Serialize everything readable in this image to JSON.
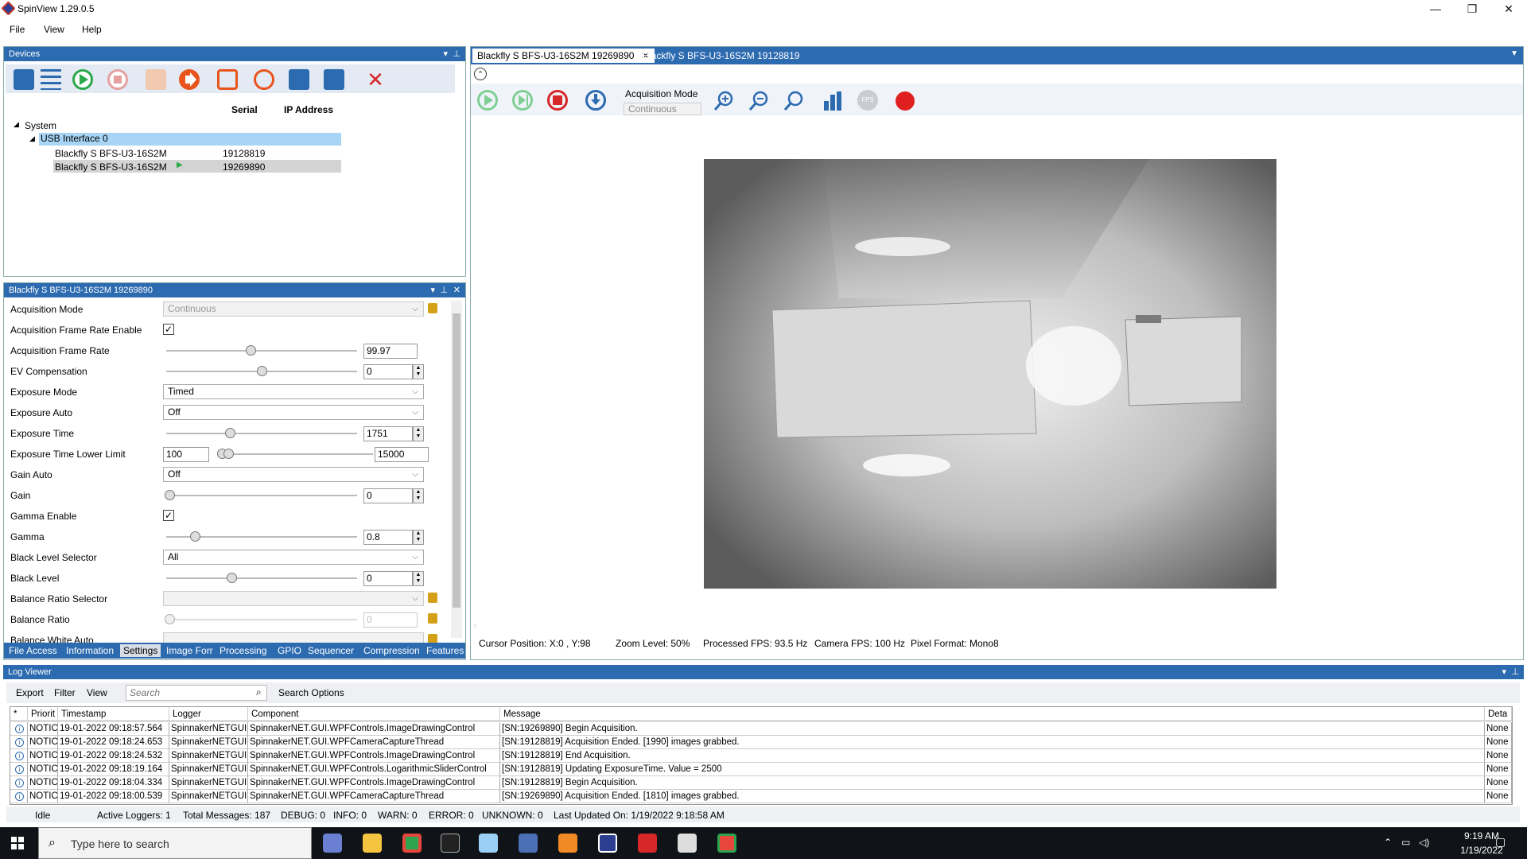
{
  "window": {
    "title": "SpinView 1.29.0.5",
    "minimize": "—",
    "restore": "❐",
    "close": "✕"
  },
  "menu": [
    "File",
    "View",
    "Help"
  ],
  "devices_panel": {
    "title": "Devices",
    "col_serial": "Serial",
    "col_ip": "IP Address",
    "tree": {
      "system": "System",
      "usb": "USB Interface 0",
      "cam1_name": "Blackfly S BFS-U3-16S2M",
      "cam1_serial": "19128819",
      "cam2_name": "Blackfly S BFS-U3-16S2M",
      "cam2_serial": "19269890"
    }
  },
  "props_panel": {
    "title": "Blackfly S BFS-U3-16S2M 19269890",
    "rows": {
      "acq_mode": {
        "label": "Acquisition Mode",
        "value": "Continuous"
      },
      "afr_enable": {
        "label": "Acquisition Frame Rate Enable",
        "checked": "✓"
      },
      "afr": {
        "label": "Acquisition Frame Rate",
        "value": "99.97"
      },
      "ev": {
        "label": "EV Compensation",
        "value": "0"
      },
      "exp_mode": {
        "label": "Exposure Mode",
        "value": "Timed"
      },
      "exp_auto": {
        "label": "Exposure Auto",
        "value": "Off"
      },
      "exp_time": {
        "label": "Exposure Time",
        "value": "1751"
      },
      "exp_lower": {
        "label": "Exposure Time Lower Limit",
        "low": "100",
        "high": "15000"
      },
      "gain_auto": {
        "label": "Gain Auto",
        "value": "Off"
      },
      "gain": {
        "label": "Gain",
        "value": "0"
      },
      "gamma_enable": {
        "label": "Gamma Enable",
        "checked": "✓"
      },
      "gamma": {
        "label": "Gamma",
        "value": "0.8"
      },
      "bl_sel": {
        "label": "Black Level Selector",
        "value": "All"
      },
      "bl": {
        "label": "Black Level",
        "value": "0"
      },
      "br_sel": {
        "label": "Balance Ratio Selector",
        "value": ""
      },
      "br": {
        "label": "Balance Ratio",
        "value": "0"
      },
      "bw_auto": {
        "label": "Balance White Auto",
        "value": ""
      }
    },
    "tabs": [
      "File Access",
      "Information",
      "Settings",
      "Image Forr",
      "Processing",
      "GPIO",
      "Sequencer",
      "Compression",
      "Features"
    ]
  },
  "viewer": {
    "tab1": "Blackfly S BFS-U3-16S2M 19269890",
    "tab1_close": "✕",
    "tab2": "Blackfly S BFS-U3-16S2M 19128819",
    "acq_mode_label": "Acquisition Mode",
    "acq_mode_value": "Continuous",
    "status": {
      "cursor": "Cursor Position: X:0 , Y:98",
      "zoom": "Zoom Level: 50%",
      "proc_fps": "Processed FPS: 93.5 Hz",
      "cam_fps": "Camera FPS: 100 Hz",
      "pixfmt": "Pixel Format: Mono8"
    }
  },
  "log": {
    "title": "Log Viewer",
    "toolbar": {
      "export": "Export",
      "filter": "Filter",
      "view": "View",
      "search_placeholder": "Search",
      "search_options": "Search Options"
    },
    "headers": [
      "*",
      "Priorit",
      "Timestamp",
      "Logger",
      "Component",
      "Message",
      "Deta"
    ],
    "rows": [
      {
        "priority": "NOTICE",
        "timestamp": "19-01-2022 09:18:57.564",
        "logger": "SpinnakerNETGUI",
        "component": "SpinnakerNET.GUI.WPFControls.ImageDrawingControl",
        "message": "[SN:19269890] Begin Acquisition.",
        "detail": "None"
      },
      {
        "priority": "NOTICE",
        "timestamp": "19-01-2022 09:18:24.653",
        "logger": "SpinnakerNETGUI",
        "component": "SpinnakerNET.GUI.WPFCameraCaptureThread",
        "message": "[SN:19128819] Acquisition Ended. [1990] images grabbed.",
        "detail": "None"
      },
      {
        "priority": "NOTICE",
        "timestamp": "19-01-2022 09:18:24.532",
        "logger": "SpinnakerNETGUI",
        "component": "SpinnakerNET.GUI.WPFControls.ImageDrawingControl",
        "message": "[SN:19128819] End Acquisition.",
        "detail": "None"
      },
      {
        "priority": "NOTICE",
        "timestamp": "19-01-2022 09:18:19.164",
        "logger": "SpinnakerNETGUI",
        "component": "SpinnakerNET.GUI.WPFControls.LogarithmicSliderControl",
        "message": "[SN:19128819] Updating ExposureTime. Value = 2500",
        "detail": "None"
      },
      {
        "priority": "NOTICE",
        "timestamp": "19-01-2022 09:18:04.334",
        "logger": "SpinnakerNETGUI",
        "component": "SpinnakerNET.GUI.WPFControls.ImageDrawingControl",
        "message": "[SN:19128819] Begin Acquisition.",
        "detail": "None"
      },
      {
        "priority": "NOTICE",
        "timestamp": "19-01-2022 09:18:00.539",
        "logger": "SpinnakerNETGUI",
        "component": "SpinnakerNET.GUI.WPFCameraCaptureThread",
        "message": "[SN:19269890] Acquisition Ended. [1810] images grabbed.",
        "detail": "None"
      }
    ],
    "status": {
      "state": "Idle",
      "loggers": "Active Loggers: 1",
      "total": "Total Messages: 187",
      "debug": "DEBUG: 0",
      "info": "INFO: 0",
      "warn": "WARN: 0",
      "error": "ERROR: 0",
      "unknown": "UNKNOWN: 0",
      "updated": "Last Updated On: 1/19/2022 9:18:58 AM"
    }
  },
  "taskbar": {
    "search_placeholder": "Type here to search",
    "time": "9:19 AM",
    "date": "1/19/2022"
  },
  "colors": {
    "accent": "#2d6bb0",
    "play": "#2aa84a",
    "stop": "#d62828",
    "orange": "#e8541c"
  }
}
